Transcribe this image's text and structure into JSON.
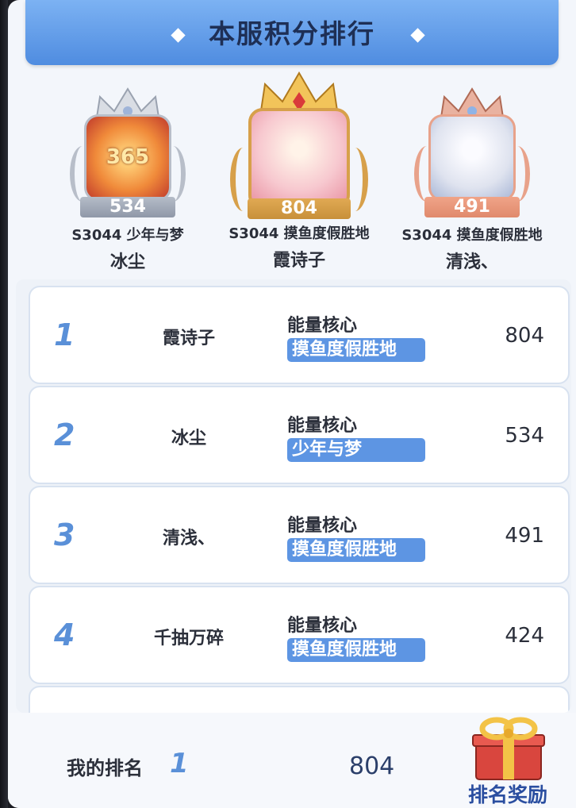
{
  "header": {
    "title": "本服积分排行"
  },
  "podium": [
    {
      "place": 2,
      "score": "534",
      "server": "S3044",
      "guild": "少年与梦",
      "name": "冰尘",
      "overlay_text": "365"
    },
    {
      "place": 1,
      "score": "804",
      "server": "S3044",
      "guild": "摸鱼度假胜地",
      "name": "霞诗子"
    },
    {
      "place": 3,
      "score": "491",
      "server": "S3044",
      "guild": "摸鱼度假胜地",
      "name": "清浅、"
    }
  ],
  "ranking": [
    {
      "rank": "1",
      "name": "霞诗子",
      "label": "能量核心",
      "guild": "摸鱼度假胜地",
      "score": "804"
    },
    {
      "rank": "2",
      "name": "冰尘",
      "label": "能量核心",
      "guild": "少年与梦",
      "score": "534"
    },
    {
      "rank": "3",
      "name": "清浅、",
      "label": "能量核心",
      "guild": "摸鱼度假胜地",
      "score": "491"
    },
    {
      "rank": "4",
      "name": "千抽万碎",
      "label": "能量核心",
      "guild": "摸鱼度假胜地",
      "score": "424"
    }
  ],
  "footer": {
    "my_rank_label": "我的排名",
    "my_rank": "1",
    "my_score": "804",
    "reward_label": "排名奖励"
  },
  "colors": {
    "title_bar": "#5a95e6",
    "rank_number": "#5a90d8",
    "guild_tag": "#5d95e3",
    "gold_badge": "#c8903a",
    "silver_badge": "#8f98a8",
    "bronze_badge": "#e08a6c"
  }
}
